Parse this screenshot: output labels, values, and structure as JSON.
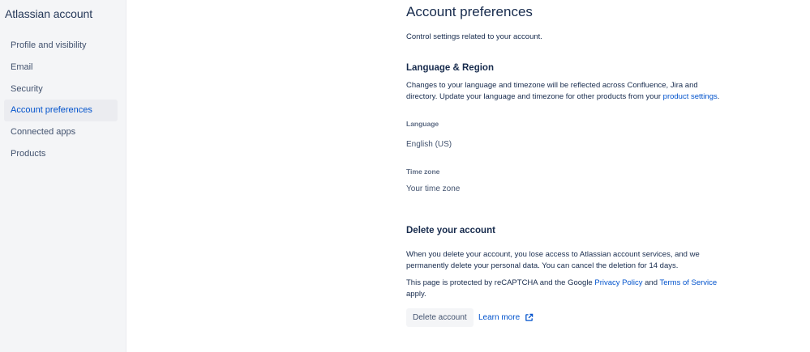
{
  "sidebar": {
    "title": "Atlassian account",
    "items": [
      {
        "label": "Profile and visibility"
      },
      {
        "label": "Email"
      },
      {
        "label": "Security"
      },
      {
        "label": "Account preferences"
      },
      {
        "label": "Connected apps"
      },
      {
        "label": "Products"
      }
    ]
  },
  "main": {
    "title": "Account preferences",
    "intro": "Control settings related to your account.",
    "language_region": {
      "heading": "Language & Region",
      "description": "Changes to your language and timezone will be reflected across Confluence, Jira and directory. Update your language and timezone for other products from your",
      "link": "product settings",
      "after_link": ".",
      "language_label": "Language",
      "language_value": "English (US)",
      "timezone_label": "Time zone",
      "timezone_value": "Your time zone"
    },
    "delete_account": {
      "heading": "Delete your account",
      "description": "When you delete your account, you lose access to Atlassian account services, and we permanently delete your personal data. You can cancel the deletion for 14 days.",
      "recaptcha_prefix": "This page is protected by reCAPTCHA and the Google",
      "privacy_link": "Privacy Policy",
      "and": "and",
      "terms_link": "Terms of Service",
      "recaptcha_suffix": "apply.",
      "button_label": "Delete account",
      "learn_more": "Learn more"
    }
  },
  "colors": {
    "sidebar_bg": "#f4f5f7",
    "active_bg": "#ebecf0",
    "link": "#0052cc",
    "text": "#172b4d"
  },
  "icons": {
    "learn_more": "external-link-icon"
  }
}
